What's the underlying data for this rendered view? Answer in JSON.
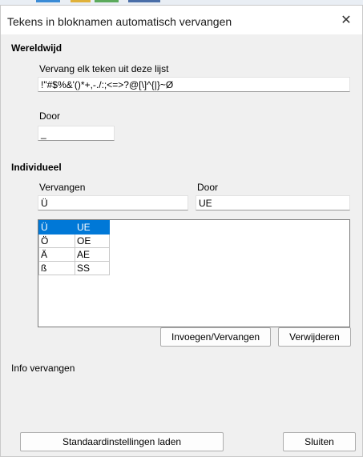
{
  "window": {
    "title": "Tekens in bloknamen automatisch vervangen",
    "close_glyph": "✕"
  },
  "global": {
    "heading": "Wereldwijd",
    "replace_label": "Vervang elk teken uit deze lijst",
    "replace_value": "!\"#$%&'()*+,-./:;<=>?@[\\]^{|}~Ø",
    "by_label": "Door",
    "by_value": "_"
  },
  "individual": {
    "heading": "Individueel",
    "replace_label": "Vervangen",
    "by_label": "Door",
    "replace_value": "Ü",
    "by_value": "UE",
    "rows": [
      {
        "from": "Ü",
        "to": "UE",
        "selected": true
      },
      {
        "from": "Ö",
        "to": "OE",
        "selected": false
      },
      {
        "from": "Ä",
        "to": "AE",
        "selected": false
      },
      {
        "from": "ß",
        "to": "SS",
        "selected": false
      }
    ],
    "insert_button": "Invoegen/Vervangen",
    "delete_button": "Verwijderen"
  },
  "info_label": "Info vervangen",
  "footer": {
    "defaults_button": "Standaardinstellingen laden",
    "close_button": "Sluiten"
  },
  "colors": {
    "selection": "#0078d7",
    "dialog_bg": "#f0f0f0"
  },
  "icons": {
    "close": "close-icon"
  }
}
